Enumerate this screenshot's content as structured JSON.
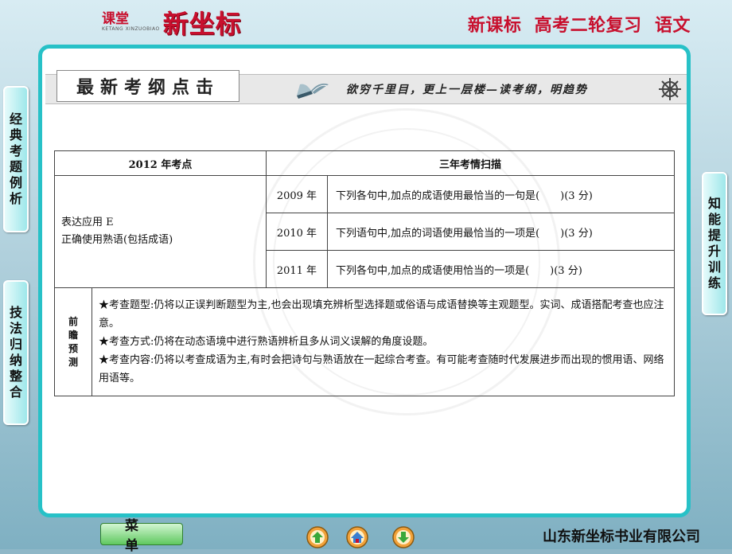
{
  "header": {
    "logo_small": "课堂",
    "logo_sub": "KETANG XINZUOBIAO",
    "logo_big": "新坐标",
    "title": "新课标  高考二轮复习  语文"
  },
  "banner": {
    "label": "最新考纲点击",
    "slogan": "欲穷千里目，更上一层楼—读考纲，明趋势"
  },
  "left_tabs": [
    {
      "label": "经典考题例析"
    },
    {
      "label": "技法归纳整合"
    }
  ],
  "right_tab": {
    "label": "知能提升训练"
  },
  "table": {
    "col1_header": "2012 年考点",
    "col2_header": "三年考情扫描",
    "topic_line1": "表达应用 E",
    "topic_line2": "正确使用熟语(包括成语)",
    "rows": [
      {
        "year": "2009 年",
        "question": "下列各句中,加点的成语使用最恰当的一句是(　　)(3 分)"
      },
      {
        "year": "2010 年",
        "question": "下列语句中,加点的词语使用最恰当的一项是(　　)(3 分)"
      },
      {
        "year": "2011 年",
        "question": "下列各句中,加点的成语使用恰当的一项是(　　)(3 分)"
      }
    ],
    "forecast_label": "前瞻预测",
    "forecast": [
      "★考查题型:仍将以正误判断题型为主,也会出现填充辨析型选择题或俗语与成语替换等主观题型。实词、成语搭配考查也应注意。",
      "★考查方式:仍将在动态语境中进行熟语辨析且多从词义误解的角度设题。",
      "★考查内容:仍将以考查成语为主,有时会把诗句与熟语放在一起综合考查。有可能考查随时代发展进步而出现的惯用语、网络用语等。"
    ]
  },
  "footer": {
    "menu_label": "菜单",
    "company": "山东新坐标书业有限公司"
  },
  "icons": [
    "book-icon",
    "dharma-wheel-icon",
    "home-up-icon",
    "home-icon",
    "down-arrow-icon"
  ],
  "colors": {
    "brand_red": "#c8102e",
    "frame_teal": "#27c1c7",
    "tab_cyan": "#9ee7ea",
    "menu_green": "#5fc85f"
  }
}
